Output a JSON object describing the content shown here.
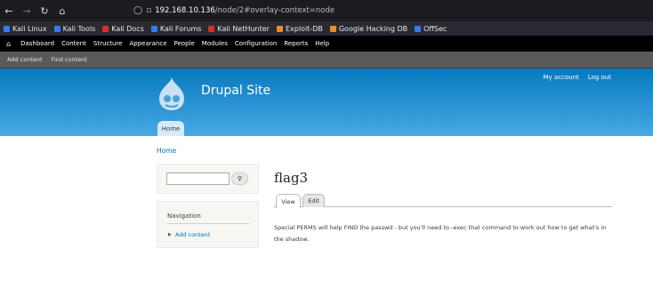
{
  "browser": {
    "url_host": "192.168.10.136",
    "url_path": "/node/2#overlay-context=node",
    "bookmarks": [
      {
        "label": "Kali Linux",
        "color": "#367bf0"
      },
      {
        "label": "Kali Tools",
        "color": "#367bf0"
      },
      {
        "label": "Kali Docs",
        "color": "#d93025"
      },
      {
        "label": "Kali Forums",
        "color": "#367bf0"
      },
      {
        "label": "Kali NetHunter",
        "color": "#d93025"
      },
      {
        "label": "Exploit-DB",
        "color": "#f08a24"
      },
      {
        "label": "Google Hacking DB",
        "color": "#f08a24"
      },
      {
        "label": "OffSec",
        "color": "#367bf0"
      }
    ]
  },
  "toolbar": {
    "items": [
      "Dashboard",
      "Content",
      "Structure",
      "Appearance",
      "People",
      "Modules",
      "Configuration",
      "Reports",
      "Help"
    ]
  },
  "shortcuts": {
    "items": [
      "Add content",
      "Find content"
    ]
  },
  "header": {
    "site_name": "Drupal Site",
    "secondary_menu": [
      "My account",
      "Log out"
    ],
    "main_menu_home": "Home"
  },
  "breadcrumb": "Home",
  "sidebar": {
    "navigation_title": "Navigation",
    "navigation_item": "Add content"
  },
  "main": {
    "title": "flag3",
    "tabs": [
      "View",
      "Edit"
    ],
    "body": "Special PERMS will help FIND the passwd - but you'll need to -exec that command to work out how to get what's in the shadow."
  },
  "colors": {
    "header_top": "#0779bf",
    "header_bottom": "#48a9e4",
    "link": "#0071b3"
  }
}
